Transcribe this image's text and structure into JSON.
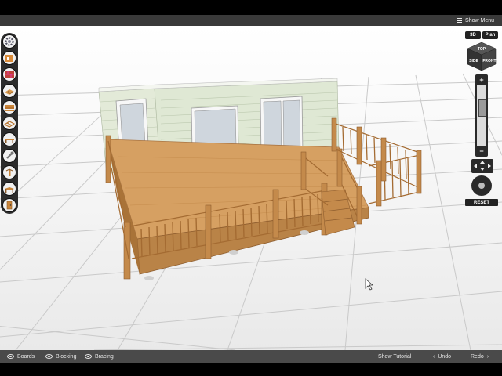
{
  "menu": {
    "show_menu_label": "Show Menu",
    "icon": "hamburger-icon"
  },
  "toolbar": {
    "tools": [
      {
        "name": "settings-gear-icon"
      },
      {
        "name": "house-icon"
      },
      {
        "name": "brick-wall-icon"
      },
      {
        "name": "deck-boards-icon"
      },
      {
        "name": "lumber-stack-icon"
      },
      {
        "name": "deck-frame-icon"
      },
      {
        "name": "bench-icon"
      },
      {
        "name": "wrench-icon"
      },
      {
        "name": "post-icon"
      },
      {
        "name": "table-icon"
      },
      {
        "name": "door-icon"
      }
    ]
  },
  "view_controls": {
    "btn_3d": "3D",
    "btn_plan": "Plan",
    "cube_top": "TOP",
    "cube_side": "SIDE",
    "cube_front": "FRONT",
    "zoom_in": "+",
    "zoom_out": "−",
    "reset_label": "RESET"
  },
  "bottom_bar": {
    "boards_label": "Boards",
    "blocking_label": "Blocking",
    "bracing_label": "Bracing",
    "tutorial_label": "Show Tutorial",
    "undo_label": "Undo",
    "redo_label": "Redo"
  },
  "colors": {
    "deck_wood": "#d6a062",
    "house_siding": "#dfe8d4",
    "toolbar_bg": "#2c2c2c",
    "bar_bg": "#4a4a4a"
  }
}
